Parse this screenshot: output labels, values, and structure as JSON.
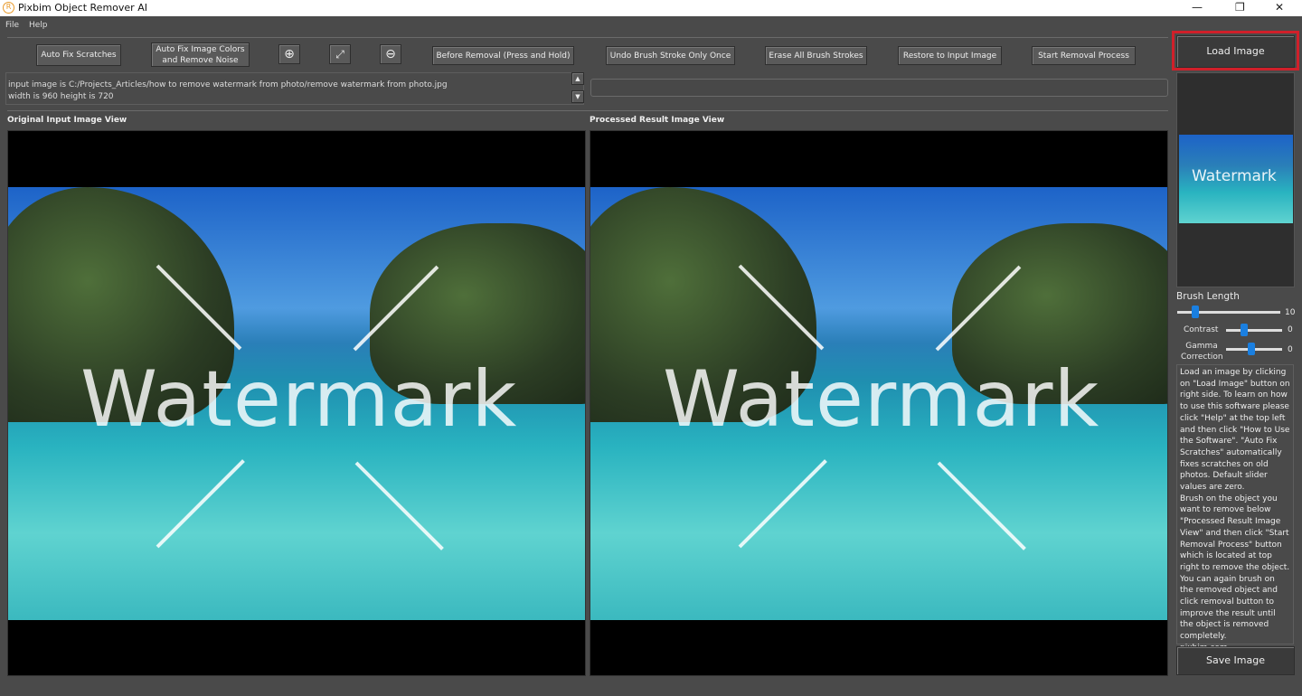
{
  "window": {
    "title": "Pixbim Object Remover AI",
    "logo_letter": "R"
  },
  "menu": [
    "File",
    "Help"
  ],
  "toolbar": {
    "auto_fix_scratches": "Auto Fix Scratches",
    "auto_fix_colors": "Auto Fix Image Colors and Remove Noise",
    "zoom_in": "zoom-in-icon",
    "fit": "fit-screen-icon",
    "zoom_out": "zoom-out-icon",
    "before_removal": "Before Removal (Press and Hold)",
    "undo_stroke": "Undo Brush Stroke Only Once",
    "erase_strokes": "Erase All Brush Strokes",
    "restore_input": "Restore to Input Image",
    "start_removal": "Start Removal Process",
    "load_image": "Load Image",
    "save_image": "Save Image"
  },
  "info": {
    "line1": "input image is C:/Projects_Articles/how to remove watermark from photo/remove watermark from photo.jpg",
    "line2": "width is 960 height is 720",
    "progress": ""
  },
  "views": {
    "original_label": "Original Input Image View",
    "processed_label": "Processed Result Image View",
    "watermark_text": "Watermark"
  },
  "controls": {
    "brush_length_label": "Brush Length",
    "brush_length_value": "10",
    "brush_fraction": 0.15,
    "contrast_label": "Contrast",
    "contrast_value": "0",
    "contrast_fraction": 0.3,
    "gamma_label": "Gamma Correction",
    "gamma_value": "0",
    "gamma_fraction": 0.45
  },
  "help_text": "Load an image by clicking on \"Load Image\" button on right side. To learn on how to use this software please click \"Help\" at the top left and then click \"How to Use the Software\". \"Auto Fix Scratches\" automatically fixes scratches on old photos. Default slider values are zero.\nBrush on the object you want to remove below \"Processed Result Image View\" and then click \"Start Removal Process\" button which is located at top right to remove the object.\n You can again brush on the removed object and click removal button to improve the result until the object is removed completely.\npixbim.com",
  "colors": {
    "accent": "#1a7fe0",
    "highlight": "#d0202a",
    "background": "#4a4a4a"
  }
}
